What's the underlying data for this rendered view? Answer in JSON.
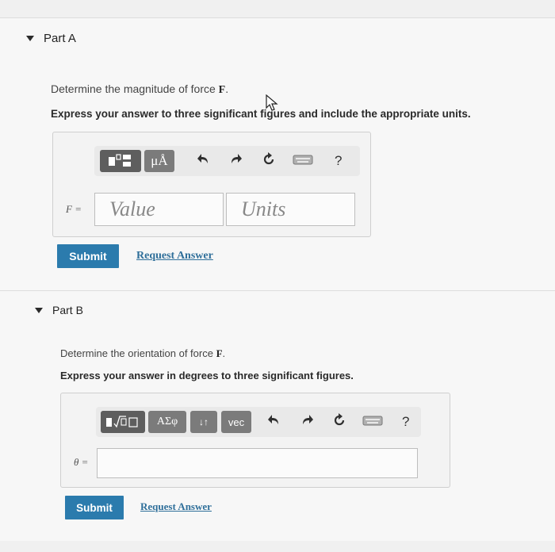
{
  "part_a": {
    "title": "Part A",
    "question_prefix": "Determine the magnitude of force ",
    "question_symbol": "F",
    "question_suffix": ".",
    "instruction": "Express your answer to three significant figures and include the appropriate units.",
    "toolbar": {
      "units_button": "μÅ",
      "help": "?"
    },
    "variable_label": "F =",
    "value_placeholder": "Value",
    "units_placeholder": "Units",
    "submit_label": "Submit",
    "request_label": "Request Answer"
  },
  "part_b": {
    "title": "Part B",
    "question_prefix": "Determine the orientation of force ",
    "question_symbol": "F",
    "question_suffix": ".",
    "instruction": "Express your answer in degrees to three significant figures.",
    "toolbar": {
      "greek_button": "ΑΣφ",
      "arrows_button": "↓↑",
      "vec_button": "vec",
      "help": "?"
    },
    "variable_label": "θ =",
    "submit_label": "Submit",
    "request_label": "Request Answer"
  },
  "colors": {
    "accent": "#2b7bad",
    "link": "#2f6f9a",
    "tool_button": "#7b7b7b"
  },
  "icons": [
    "caret-down-icon",
    "templates-icon",
    "radical-icon",
    "undo-icon",
    "redo-icon",
    "reset-icon",
    "keyboard-icon",
    "help-icon",
    "cursor-icon"
  ]
}
